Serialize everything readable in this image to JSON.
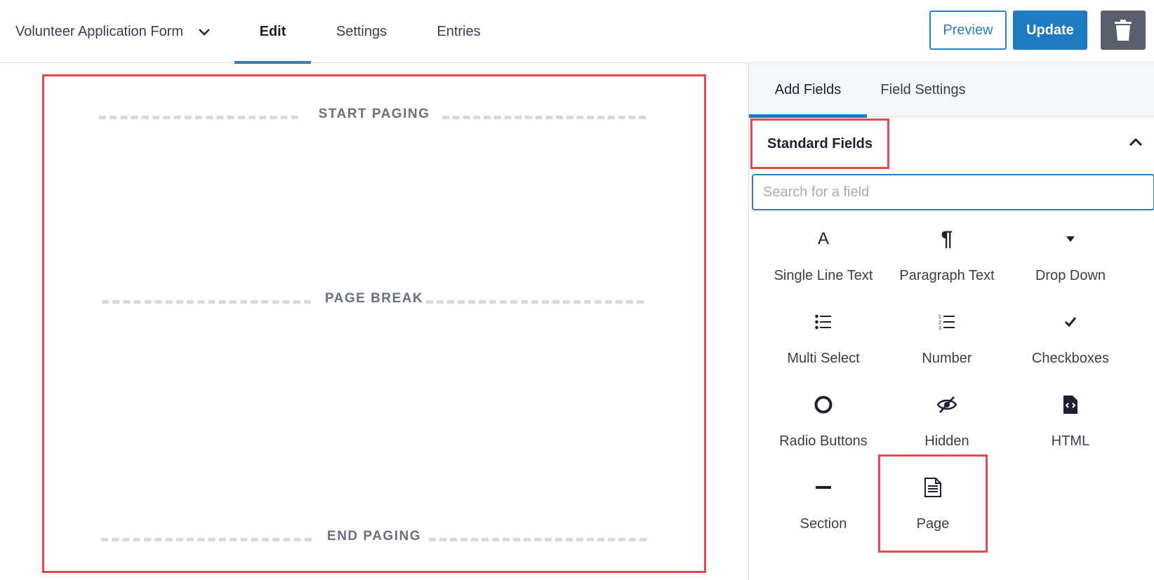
{
  "header": {
    "form_title": "Volunteer Application Form",
    "tabs": [
      {
        "label": "Edit",
        "active": true
      },
      {
        "label": "Settings",
        "active": false
      },
      {
        "label": "Entries",
        "active": false
      }
    ],
    "preview_label": "Preview",
    "update_label": "Update"
  },
  "canvas": {
    "dividers": [
      {
        "label": "START PAGING"
      },
      {
        "label": "PAGE BREAK"
      },
      {
        "label": "END PAGING"
      }
    ]
  },
  "sidebar": {
    "tabs": [
      {
        "label": "Add Fields",
        "active": true
      },
      {
        "label": "Field Settings",
        "active": false
      }
    ],
    "section_title": "Standard Fields",
    "search_placeholder": "Search for a field",
    "fields": [
      {
        "label": "Single Line Text",
        "icon": "single-line-text-icon"
      },
      {
        "label": "Paragraph Text",
        "icon": "paragraph-icon"
      },
      {
        "label": "Drop Down",
        "icon": "dropdown-icon"
      },
      {
        "label": "Multi Select",
        "icon": "list-icon"
      },
      {
        "label": "Number",
        "icon": "numbered-list-icon"
      },
      {
        "label": "Checkboxes",
        "icon": "checkmark-icon"
      },
      {
        "label": "Radio Buttons",
        "icon": "radio-circle-icon"
      },
      {
        "label": "Hidden",
        "icon": "eye-slash-icon"
      },
      {
        "label": "HTML",
        "icon": "code-file-icon"
      },
      {
        "label": "Section",
        "icon": "minus-icon"
      },
      {
        "label": "Page",
        "icon": "page-icon"
      }
    ]
  },
  "colors": {
    "accent": "#1e7bc1",
    "highlight": "#e5484d"
  }
}
